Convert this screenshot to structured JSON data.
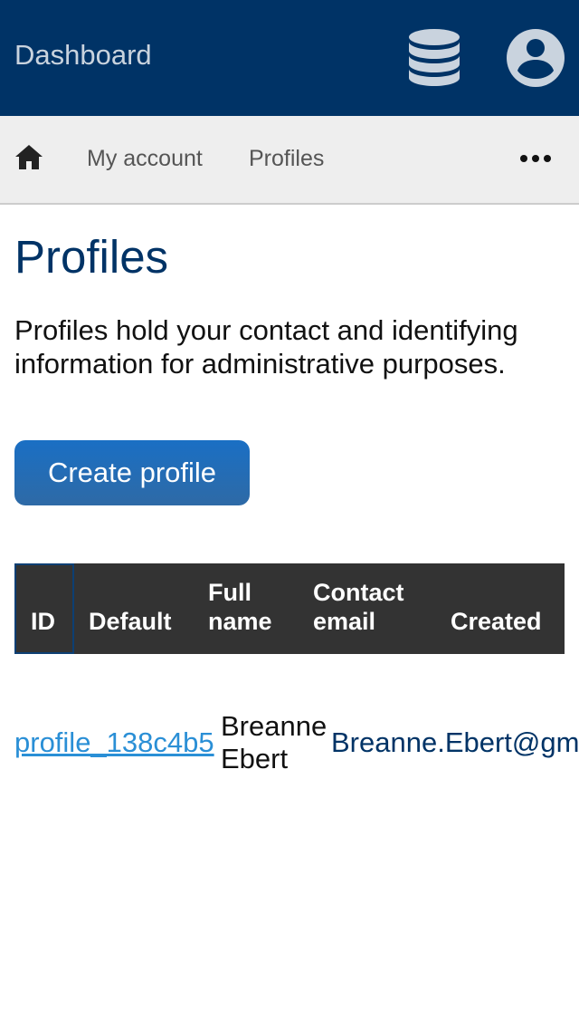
{
  "header": {
    "title": "Dashboard",
    "icons": [
      "database-icon",
      "account-circle-icon"
    ],
    "background_color": "#003366"
  },
  "nav": {
    "home_icon": "home-icon",
    "items": [
      "My account",
      "Profiles"
    ],
    "more_icon": "more-horizontal-icon"
  },
  "main": {
    "title": "Profiles",
    "description": "Profiles hold your contact and identifying information for administrative purposes.",
    "create_button_label": "Create profile"
  },
  "table": {
    "columns": [
      "ID",
      "Default",
      "Full name",
      "Contact email",
      "Created"
    ],
    "rows": [
      {
        "id": "profile_138c4b5",
        "full_name": "Breanne Ebert",
        "contact_email": "Breanne.Ebert@gm"
      }
    ]
  },
  "colors": {
    "brand": "#003366",
    "link": "#2a8fd6",
    "button": "#1a6fc4",
    "table_header": "#333333"
  }
}
